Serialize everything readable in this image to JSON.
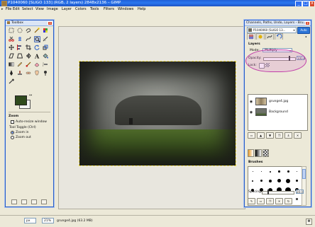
{
  "window": {
    "title": "P1040060 [SLIGO 133] (RGB, 2 layers) 2848x2136 – GIMP",
    "min_glyph": "_",
    "max_glyph": "□",
    "close_glyph": "x"
  },
  "menu": {
    "items": [
      "File",
      "Edit",
      "Select",
      "View",
      "Image",
      "Layer",
      "Colors",
      "Tools",
      "Filters",
      "Windows",
      "Help"
    ]
  },
  "toolbox": {
    "title": "Toolbox",
    "close_glyph": "x",
    "fg_color": "#2f4a1d",
    "bg_color": "#f3f3f3",
    "swap_glyph": "↔",
    "options_title": "Zoom",
    "auto_resize_label": "Auto-resize window",
    "tool_toggle_label": "Tool Toggle (Ctrl)",
    "zoom_in_label": "Zoom in",
    "zoom_out_label": "Zoom out"
  },
  "dock": {
    "title": "Channels, Paths, Undo, Layers - Bru...",
    "close_glyph": "x",
    "image_select": "P1040060 [SLIGO 13...",
    "auto_label": "Auto",
    "layers_label": "Layers",
    "mode_label": "Mode:",
    "mode_value": "Multiply",
    "opacity_label": "Opacity:",
    "opacity_value": "100.0",
    "opacity_fraction": 0.85,
    "lock_label": "Lock:",
    "layers": [
      {
        "name": "grunge4.jpg",
        "selected": false
      },
      {
        "name": "Background",
        "selected": false
      }
    ],
    "brushes_label": "Brushes",
    "spacing_label": "Spacing:",
    "spacing_value": "20.0",
    "spacing_fraction": 0.2
  },
  "status": {
    "unit": "px",
    "zoom": "21%",
    "message": "grunge4.jpg (63.2 MB)"
  }
}
